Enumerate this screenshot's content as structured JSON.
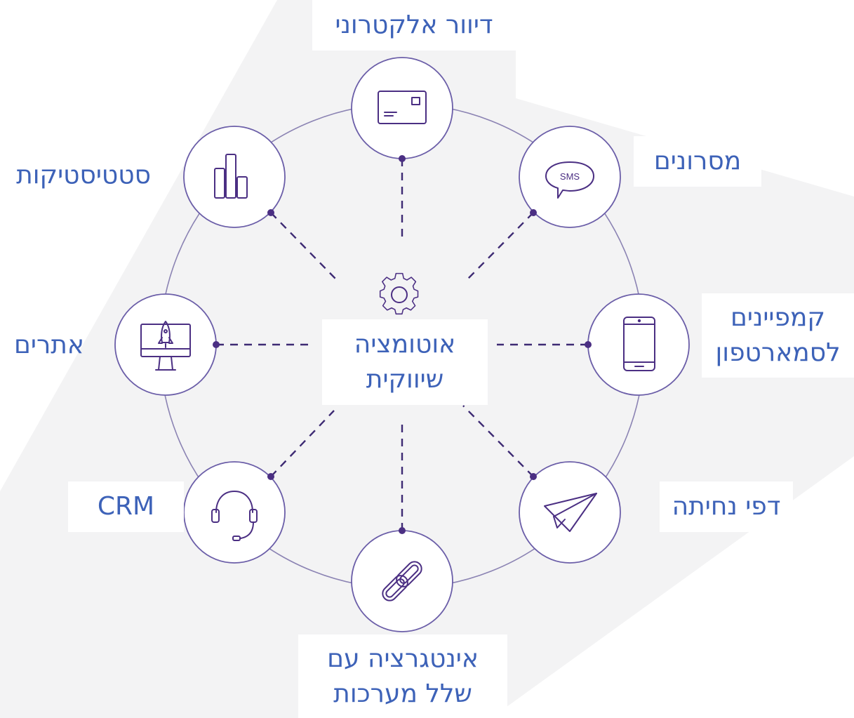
{
  "colors": {
    "background": "#ffffff",
    "band": "#f3f3f4",
    "ring": "#8b83b3",
    "node_stroke": "#6b5ea8",
    "icon": "#4b2f83",
    "dot": "#4b2f83",
    "dash": "#3d2a73",
    "text": "#3d62b8"
  },
  "center": {
    "icon": "gear-icon",
    "line1": "אוטומציה",
    "line2": "שיווקית"
  },
  "nodes": [
    {
      "id": "email",
      "icon": "envelope-icon",
      "label": "דיוור אלקטרוני"
    },
    {
      "id": "sms",
      "icon": "sms-bubble-icon",
      "icon_text": "SMS",
      "label": "מסרונים"
    },
    {
      "id": "smartphone",
      "icon": "smartphone-icon",
      "label_line1": "קמפיינים",
      "label_line2": "לסמארטפון"
    },
    {
      "id": "landing",
      "icon": "paper-plane-icon",
      "label": "דפי נחיתה"
    },
    {
      "id": "integration",
      "icon": "chain-link-icon",
      "label_line1": "אינטגרציה עם",
      "label_line2": "שלל מערכות"
    },
    {
      "id": "crm",
      "icon": "headset-icon",
      "label": "CRM"
    },
    {
      "id": "websites",
      "icon": "monitor-rocket-icon",
      "label": "אתרים"
    },
    {
      "id": "statistics",
      "icon": "bar-chart-icon",
      "label": "סטטיסטיקות"
    }
  ]
}
